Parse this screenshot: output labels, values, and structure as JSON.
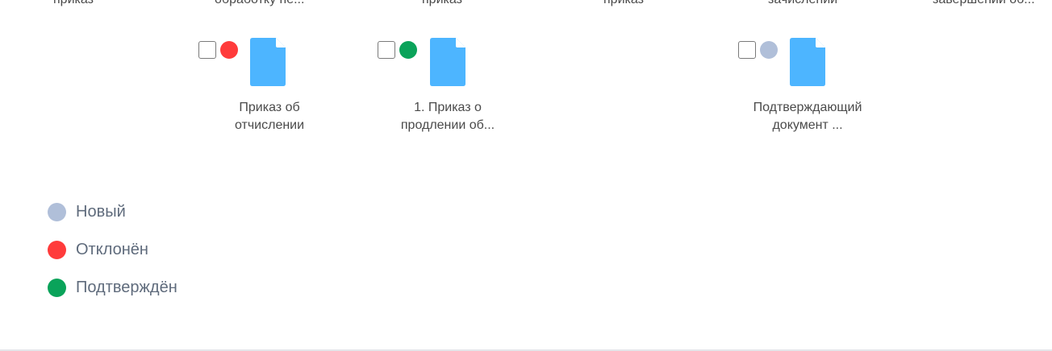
{
  "clipped_labels": [
    "приказ",
    "обработку пе...",
    "приказ",
    "приказ",
    "зачислении",
    "завершении об..."
  ],
  "documents": [
    {
      "status": "rejected",
      "status_color": "#ff3b3b",
      "name_line1": "Приказ об",
      "name_line2": "отчислении",
      "icon": "file-icon"
    },
    {
      "status": "confirmed",
      "status_color": "#0aa35a",
      "name_line1": "1. Приказ о",
      "name_line2": "продлении об...",
      "icon": "file-icon"
    },
    {
      "status": "new",
      "status_color": "#b0bfd9",
      "name_line1": "Подтверждающий",
      "name_line2": "документ ...",
      "icon": "file-icon"
    }
  ],
  "legend": [
    {
      "label": "Новый",
      "color": "#b0bfd9"
    },
    {
      "label": "Отклонён",
      "color": "#ff3b3b"
    },
    {
      "label": "Подтверждён",
      "color": "#0aa35a"
    }
  ],
  "colors": {
    "file_icon": "#4db5ff",
    "file_fold": "#ffffff"
  }
}
